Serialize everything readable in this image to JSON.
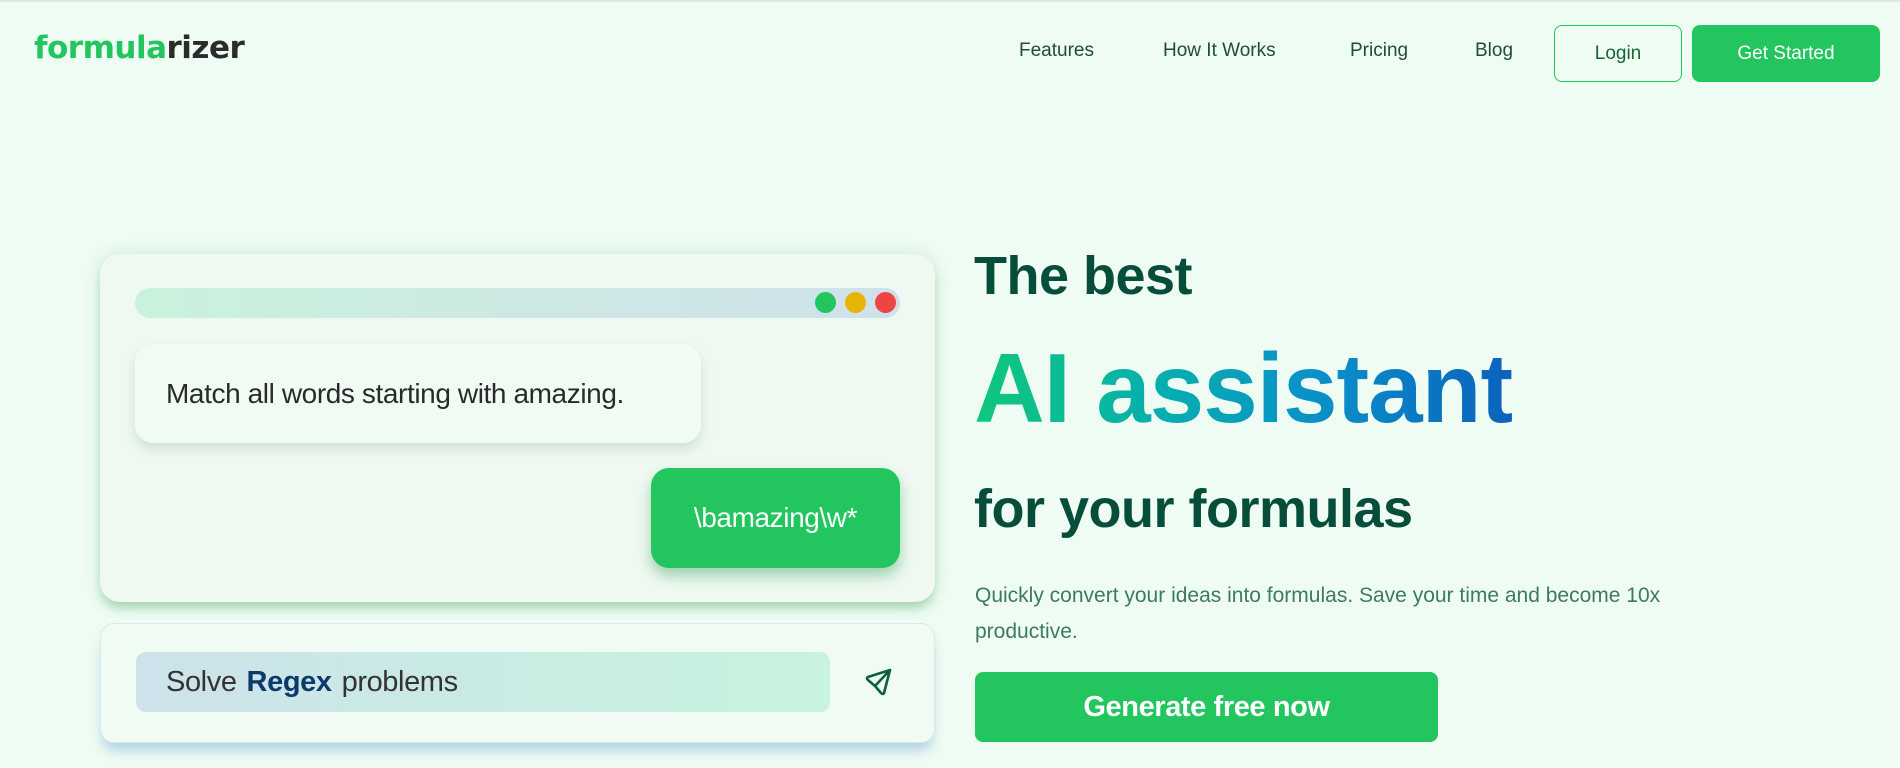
{
  "brand": {
    "logo_part1": "formula",
    "logo_part2": "rizer"
  },
  "nav": {
    "links": [
      {
        "label": "Features"
      },
      {
        "label": "How It Works"
      },
      {
        "label": "Pricing"
      },
      {
        "label": "Blog"
      }
    ],
    "login_label": "Login",
    "get_started_label": "Get Started"
  },
  "demo": {
    "window_controls": [
      {
        "name": "green-dot",
        "color": "#22c55e"
      },
      {
        "name": "yellow-dot",
        "color": "#eab308"
      },
      {
        "name": "red-dot",
        "color": "#ef4444"
      }
    ],
    "user_message": "Match all words starting with amazing.",
    "ai_response": "\\bamazing\\w*",
    "prompt": {
      "prefix": "Solve",
      "keyword": "Regex",
      "suffix": "problems"
    },
    "send_icon": "send-icon"
  },
  "hero": {
    "line1": "The best",
    "line2": "AI assistant",
    "line3": "for your formulas",
    "subtext": "Quickly convert your ideas into formulas. Save your time and become 10x productive.",
    "cta_label": "Generate free now"
  },
  "colors": {
    "accent": "#22c55e",
    "heading": "#064e3b",
    "background": "#effcf3",
    "gradient_start": "#10c77b",
    "gradient_end": "#0b62bd",
    "keyword": "#0b3a6b"
  }
}
